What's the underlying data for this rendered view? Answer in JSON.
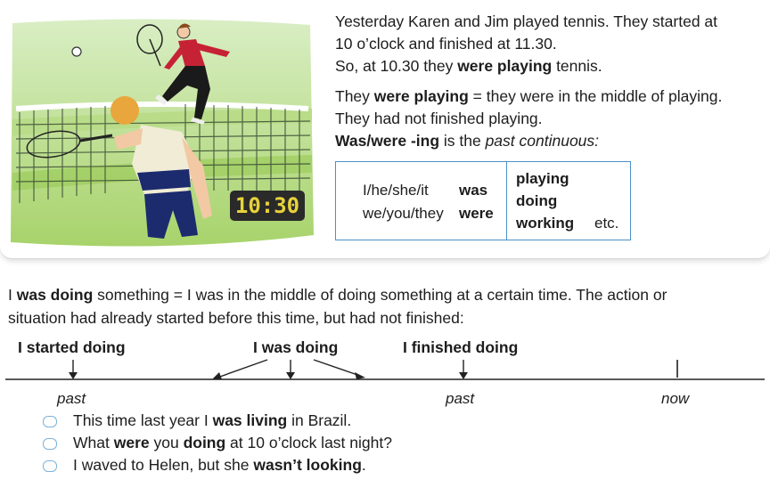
{
  "intro": {
    "line1": "Yesterday Karen and Jim played tennis.  They started at",
    "line2": "10 o’clock and finished at 11.30.",
    "line3_a": "So, at 10.30 they ",
    "line3_b": "were playing",
    "line3_c": " tennis.",
    "line4_a": "They ",
    "line4_b": "were playing",
    "line4_c": " = they were in the middle of playing.",
    "line5": "They had not finished playing.",
    "line6_a": "Was/were -ing",
    "line6_b": " is the ",
    "line6_c": "past continuous:"
  },
  "clock": {
    "time": "10:30"
  },
  "form_table": {
    "subjects": [
      "I/he/she/it",
      "we/you/they"
    ],
    "verbs": [
      "was",
      "were"
    ],
    "forms": [
      "playing",
      "doing",
      "working"
    ],
    "etc": "etc."
  },
  "explanation": {
    "a": "I ",
    "b": "was doing",
    "c": " something = I was in the middle of doing something at a certain time.  The action or",
    "d": "situation had already started before this time, but had not finished:"
  },
  "timeline": {
    "started": "I started doing",
    "was": "I was doing",
    "finished": "I finished doing",
    "past1": "past",
    "past2": "past",
    "now": "now"
  },
  "examples": [
    {
      "a": "This time last year I ",
      "b": "was living",
      "c": " in Brazil."
    },
    {
      "a": "What ",
      "b": "were",
      "c": " you ",
      "d": "doing",
      "e": " at 10 o’clock last night?"
    },
    {
      "a": "I waved to Helen, but she ",
      "b": "wasn’t looking",
      "c": "."
    }
  ],
  "colors": {
    "accent": "#4a90c8",
    "grass": "#8fc14a",
    "clock_bg": "#2a2a2a",
    "clock_digits": "#e8d23a"
  }
}
